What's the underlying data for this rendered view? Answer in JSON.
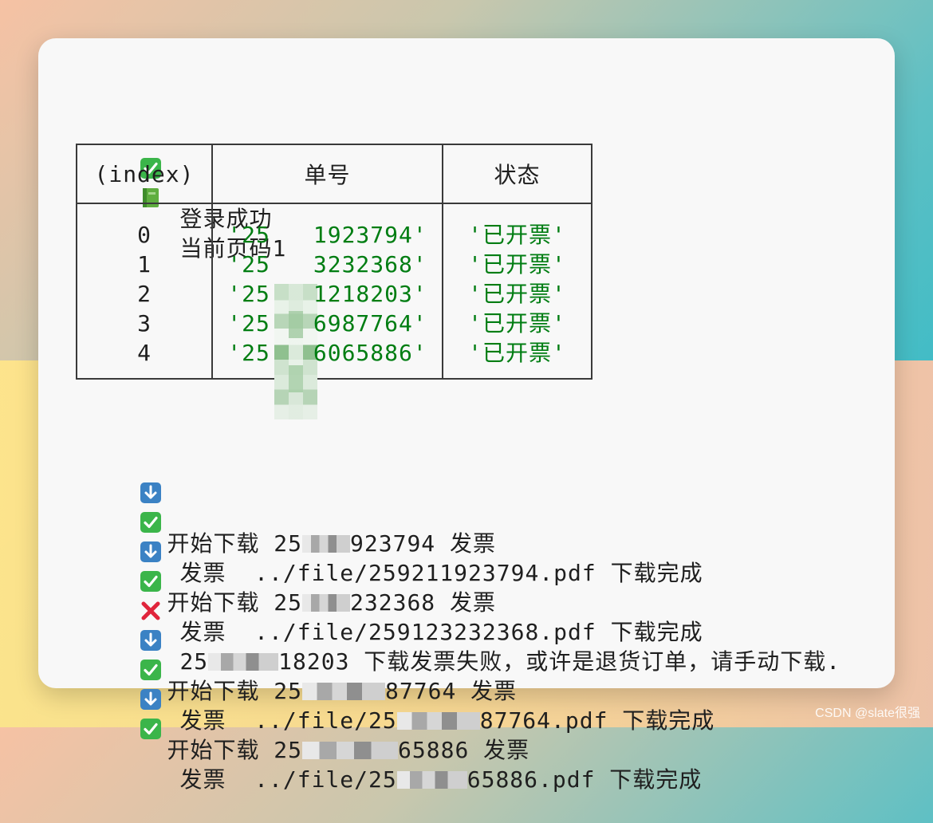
{
  "header": {
    "login_line": "登录成功",
    "page_line": "当前页码1"
  },
  "table": {
    "headers": [
      "(index)",
      "单号",
      "状态"
    ],
    "rows": [
      {
        "index": "0",
        "order_visible_start": "'25",
        "order_visible_end": "1923794'",
        "status": "'已开票'"
      },
      {
        "index": "1",
        "order_visible_start": "'25",
        "order_visible_end": "3232368'",
        "status": "'已开票'"
      },
      {
        "index": "2",
        "order_visible_start": "'25",
        "order_visible_end": "1218203'",
        "status": "'已开票'"
      },
      {
        "index": "3",
        "order_visible_start": "'25",
        "order_visible_end": "6987764'",
        "status": "'已开票'"
      },
      {
        "index": "4",
        "order_visible_start": "'25",
        "order_visible_end": "6065886'",
        "status": "'已开票'"
      }
    ]
  },
  "logs": [
    {
      "type": "download",
      "text_start": "开始下载 25",
      "text_end": "923794 发票"
    },
    {
      "type": "success",
      "text": "发票  ../file/259211923794.pdf 下载完成"
    },
    {
      "type": "download",
      "text_start": "开始下载 25",
      "text_end": "232368 发票"
    },
    {
      "type": "success",
      "text": "发票  ../file/259123232368.pdf 下载完成"
    },
    {
      "type": "error",
      "text_start": "25",
      "text_end": "18203 下载发票失败，或许是退货订单，请手动下载."
    },
    {
      "type": "download",
      "text_start": "开始下载 25",
      "text_end": "87764 发票"
    },
    {
      "type": "success_blur",
      "text_start": "发票  ../file/25",
      "text_end": "87764.pdf 下载完成"
    },
    {
      "type": "download",
      "text_start": "开始下载 25",
      "text_end": "65886 发票"
    },
    {
      "type": "success_blur",
      "text_start": "发票  ../file/25",
      "text_end": "65886.pdf 下载完成"
    }
  ],
  "watermark": "CSDN @slate很强",
  "icons": {
    "check": "white-check-mark",
    "book": "green-book",
    "down": "down-arrow",
    "cross": "red-cross"
  },
  "colors": {
    "green_text": "#007d12",
    "check_green": "#3bb54a",
    "cross_red": "#e0243b",
    "arrow_blue": "#3b82c4"
  }
}
